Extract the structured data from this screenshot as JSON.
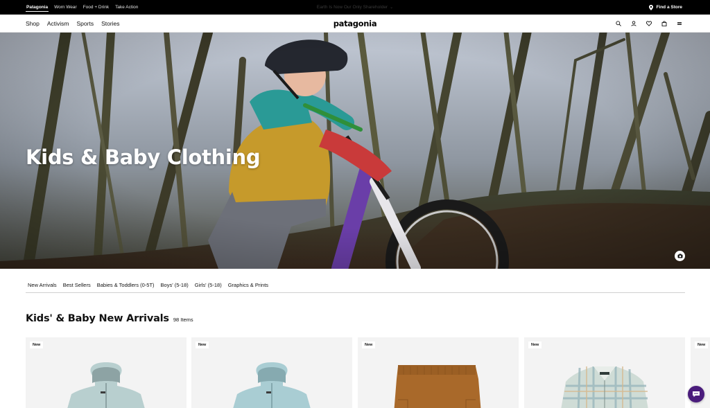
{
  "topbar": {
    "brands": [
      {
        "label": "Patagonia",
        "active": true
      },
      {
        "label": "Worn Wear",
        "active": false
      },
      {
        "label": "Food + Drink",
        "active": false
      },
      {
        "label": "Take Action",
        "active": false
      }
    ],
    "promo": "Earth Is Now Our Only Shareholder",
    "store_label": "Find a Store"
  },
  "nav": {
    "links": [
      "Shop",
      "Activism",
      "Sports",
      "Stories"
    ],
    "logo": "patagonia",
    "icons": [
      "search-icon",
      "account-icon",
      "heart-icon",
      "bag-icon",
      "menu-icon"
    ]
  },
  "hero": {
    "title": "Kids & Baby Clothing"
  },
  "categories": [
    "New Arrivals",
    "Best Sellers",
    "Babies & Toddlers (0-5T)",
    "Boys' (5-18)",
    "Girls' (5-18)",
    "Graphics & Prints"
  ],
  "section": {
    "title": "Kids' & Baby New Arrivals",
    "count": "98 Items"
  },
  "products": [
    {
      "badge": "New",
      "item": "jacket-icon",
      "color": "#b8cfcf"
    },
    {
      "badge": "New",
      "item": "jacket-icon",
      "color": "#a9cdd3"
    },
    {
      "badge": "New",
      "item": "shorts-icon",
      "color": "#a9692a"
    },
    {
      "badge": "New",
      "item": "flannel-shirt-icon",
      "color": "#cfdcd6"
    },
    {
      "badge": "New",
      "item": "product-image",
      "color": "#e8e8e8"
    }
  ],
  "colors": {
    "topbar_bg": "#000000",
    "chat_bg": "#4a1c7c",
    "card_bg": "#f3f3f3"
  }
}
